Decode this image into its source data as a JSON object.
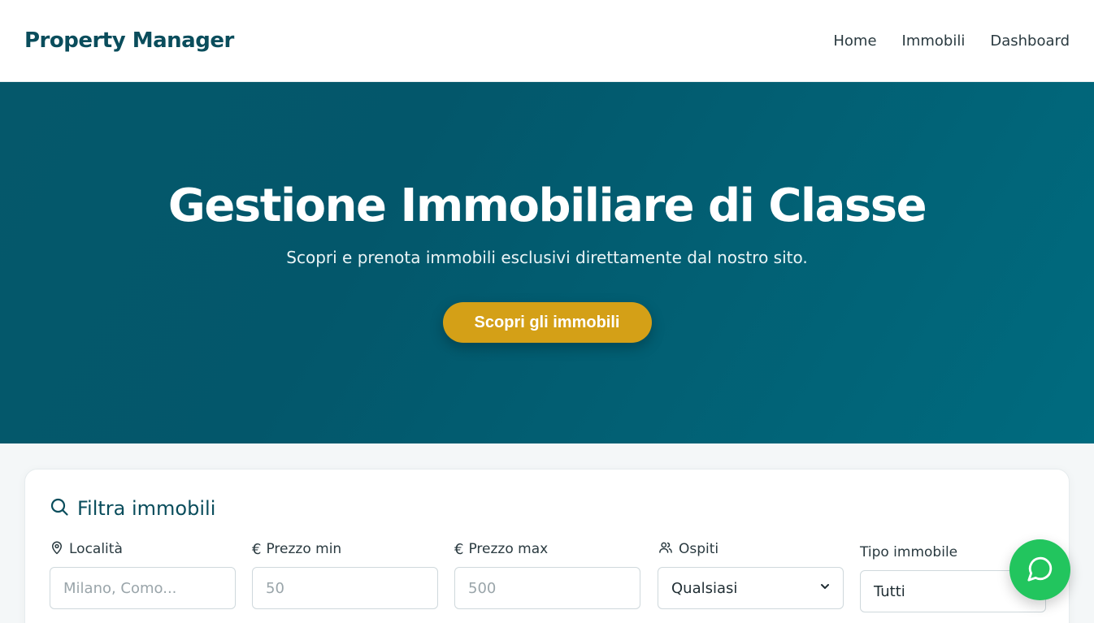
{
  "nav": {
    "brand": "Property Manager",
    "links": [
      "Home",
      "Immobili",
      "Dashboard"
    ]
  },
  "hero": {
    "title": "Gestione Immobiliare di Classe",
    "subtitle": "Scopri e prenota immobili esclusivi direttamente dal nostro sito.",
    "cta": "Scopri gli immobili"
  },
  "filter": {
    "title": "Filtra immobili",
    "fields": [
      {
        "label": "Località",
        "placeholder": "Milano, Como...",
        "icon": "map-pin-icon"
      },
      {
        "label": "Prezzo min",
        "placeholder": "50",
        "icon": "euro-icon"
      },
      {
        "label": "Prezzo max",
        "placeholder": "500",
        "icon": "euro-icon"
      },
      {
        "label": "Ospiti",
        "value": "Qualsiasi",
        "icon": "users-icon"
      },
      {
        "label": "Tipo immobile",
        "value": "Tutti"
      }
    ]
  },
  "colors": {
    "brand": "#0a4d5c",
    "hero_start": "#05586b",
    "hero_end": "#006b7f",
    "cta": "#d4a017",
    "chat": "#22c55e"
  }
}
